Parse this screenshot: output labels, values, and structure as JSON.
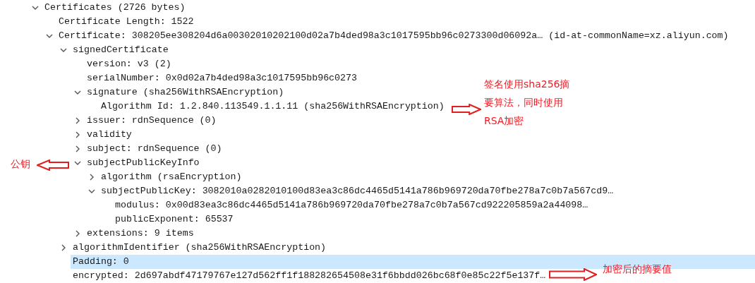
{
  "tree": [
    {
      "label": "Certificates (2726 bytes)",
      "expanded": true,
      "selected": false,
      "children": [
        {
          "label": "Certificate Length: 1522",
          "selected": false
        },
        {
          "label": "Certificate: 308205ee308204d6a00302010202100d02a7b4ded98a3c1017595bb96c0273300d06092a… (id-at-commonName=xz.aliyun.com)",
          "expanded": true,
          "selected": false,
          "children": [
            {
              "label": "signedCertificate",
              "expanded": true,
              "selected": false,
              "children": [
                {
                  "label": "version: v3 (2)",
                  "selected": false
                },
                {
                  "label": "serialNumber: 0x0d02a7b4ded98a3c1017595bb96c0273",
                  "selected": false
                },
                {
                  "label": "signature (sha256WithRSAEncryption)",
                  "expanded": true,
                  "selected": false,
                  "children": [
                    {
                      "label": "Algorithm Id: 1.2.840.113549.1.1.11 (sha256WithRSAEncryption)",
                      "selected": false
                    }
                  ]
                },
                {
                  "label": "issuer: rdnSequence (0)",
                  "expanded": false,
                  "selected": false
                },
                {
                  "label": "validity",
                  "expanded": false,
                  "selected": false
                },
                {
                  "label": "subject: rdnSequence (0)",
                  "expanded": false,
                  "selected": false
                },
                {
                  "label": "subjectPublicKeyInfo",
                  "expanded": true,
                  "selected": false,
                  "children": [
                    {
                      "label": "algorithm (rsaEncryption)",
                      "expanded": false,
                      "selected": false
                    },
                    {
                      "label": "subjectPublicKey: 3082010a0282010100d83ea3c86dc4465d5141a786b969720da70fbe278a7c0b7a567cd9…",
                      "expanded": true,
                      "selected": false,
                      "children": [
                        {
                          "label": "modulus: 0x00d83ea3c86dc4465d5141a786b969720da70fbe278a7c0b7a567cd922205859a2a44098…",
                          "selected": false
                        },
                        {
                          "label": "publicExponent: 65537",
                          "selected": false
                        }
                      ]
                    }
                  ]
                },
                {
                  "label": "extensions: 9 items",
                  "expanded": false,
                  "selected": false
                }
              ]
            },
            {
              "label": "algorithmIdentifier (sha256WithRSAEncryption)",
              "expanded": false,
              "selected": false
            },
            {
              "label": "Padding: 0",
              "selected": true
            },
            {
              "label": "encrypted: 2d697abdf47179767e127d562ff1f188282654508e31f6bbdd026bc68f0e85c22f5e137f…",
              "selected": false
            }
          ]
        }
      ]
    }
  ],
  "annotations": [
    {
      "text": "签名使用sha256摘要算法，同时使用RSA加密"
    },
    {
      "text": "公钥"
    },
    {
      "text": "加密后的摘要值"
    }
  ]
}
